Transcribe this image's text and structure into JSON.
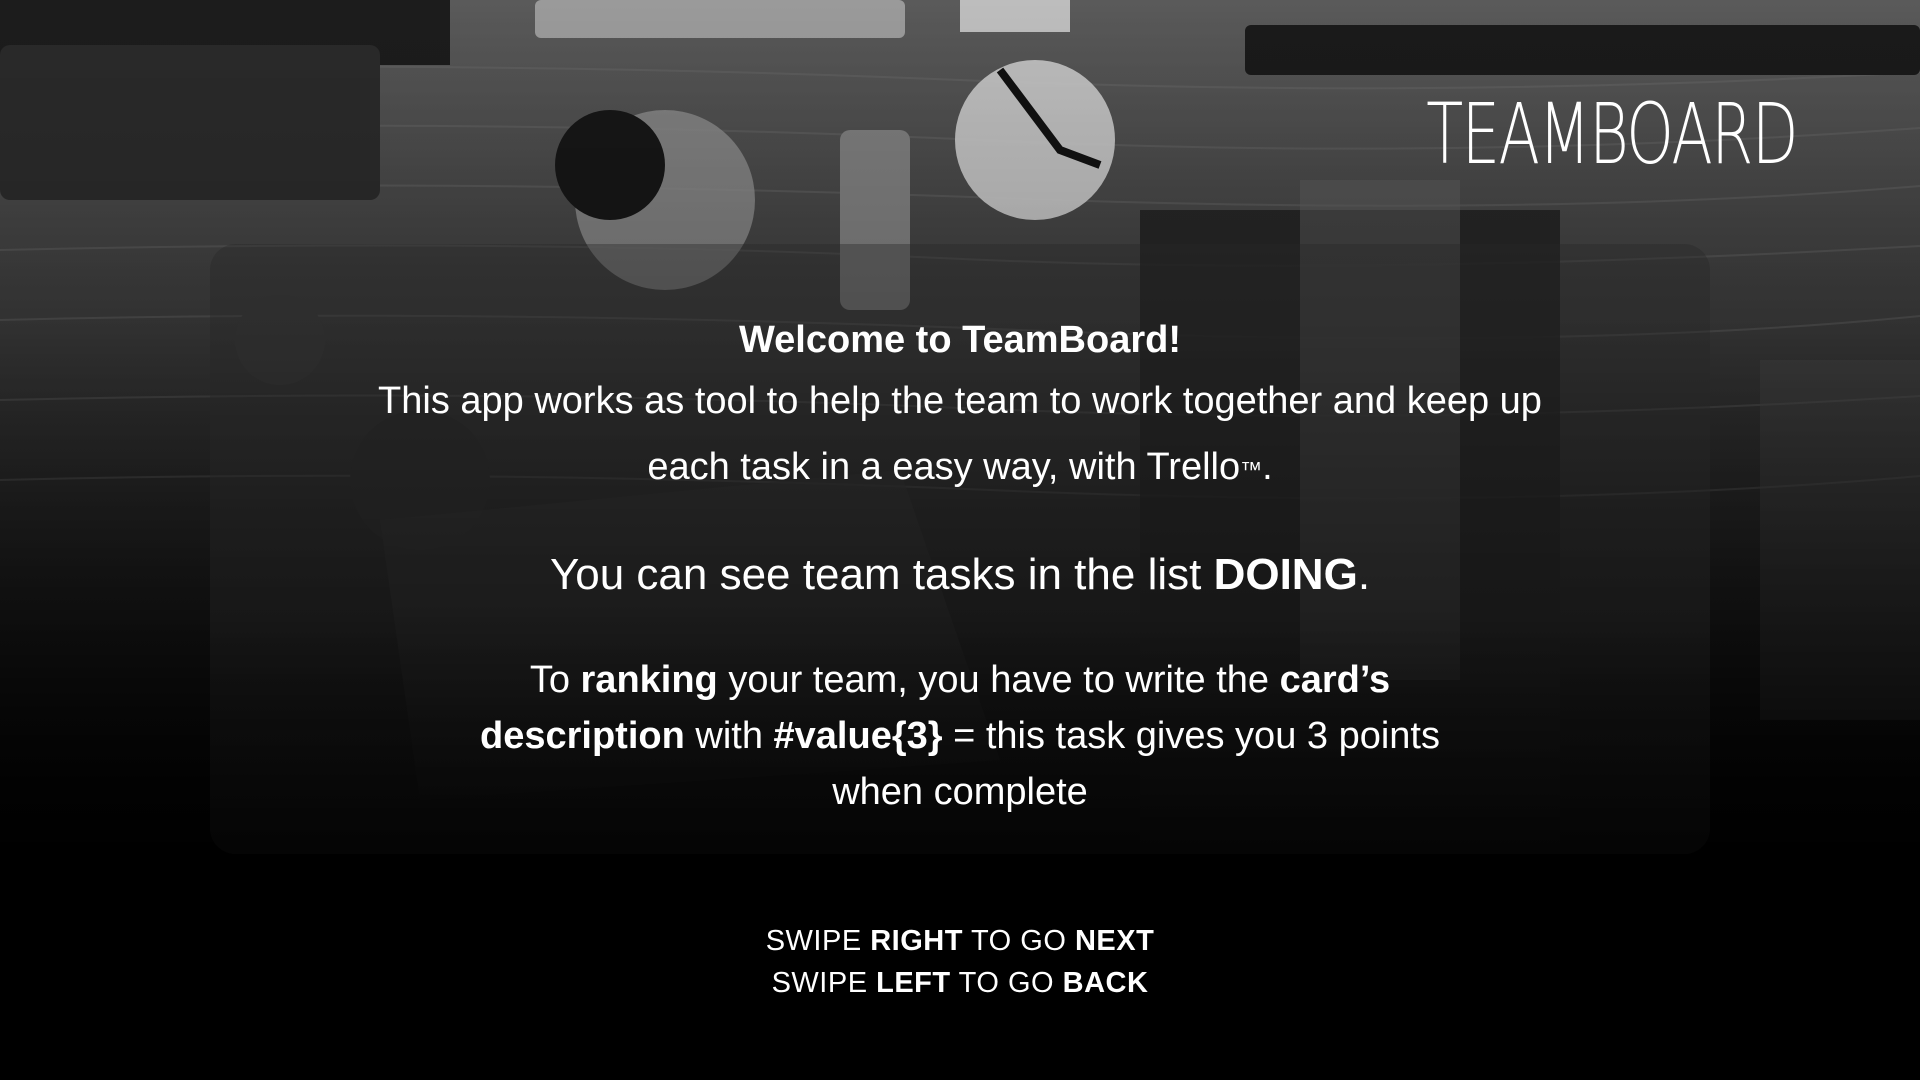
{
  "brand": {
    "logo_text": "TEAMBOARD"
  },
  "welcome": {
    "title": "Welcome to TeamBoard!",
    "intro_line_1": "This app works as tool to help the team to work together and keep up",
    "intro_line_2": "each task in a easy way, with Trello",
    "trademark": "™",
    "intro_end": "."
  },
  "doing_note": {
    "prefix": "You can see team tasks in the list ",
    "list_name": "DOING",
    "suffix": "."
  },
  "ranking_note": {
    "t1": "To ",
    "b1": "ranking",
    "t2": " your team, you have to write the ",
    "b2": "card’s description",
    "t3": " with ",
    "b3": "#value{3}",
    "t4": " = this task gives you 3 points when complete"
  },
  "navigation": {
    "swipe_word": "SWIPE ",
    "right_word": "RIGHT",
    "to_go": " TO GO ",
    "next_word": "NEXT",
    "left_word": "LEFT",
    "back_word": "BACK"
  },
  "colors": {
    "text": "#ffffff",
    "background": "#000000",
    "panel": "rgba(40,40,40,0.38)"
  }
}
